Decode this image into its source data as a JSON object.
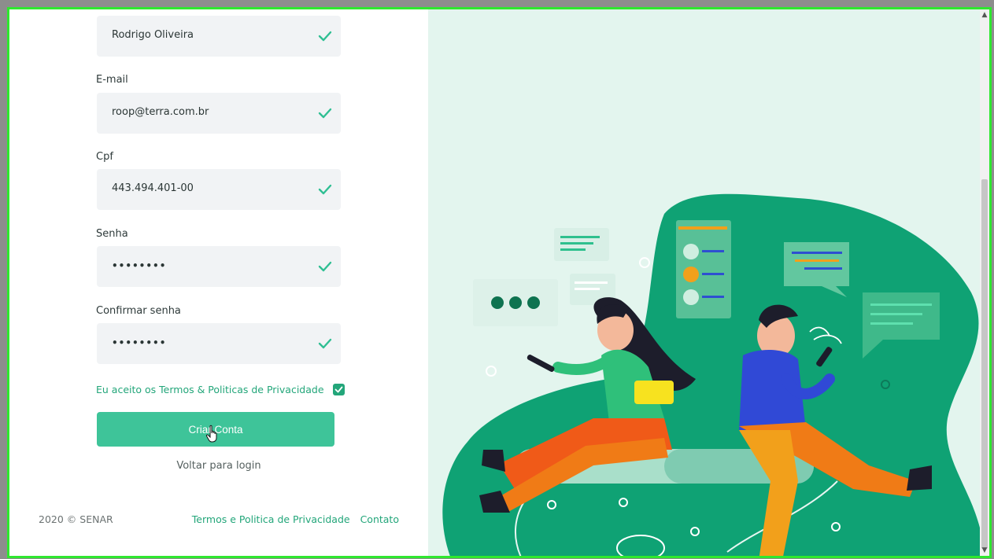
{
  "form": {
    "name_value": "Rodrigo Oliveira",
    "email_label": "E-mail",
    "email_value": "roop@terra.com.br",
    "cpf_label": "Cpf",
    "cpf_value": "443.494.401-00",
    "password_label": "Senha",
    "password_value": "••••••••",
    "confirm_label": "Confirmar senha",
    "confirm_value": "••••••••",
    "terms_text": "Eu aceito os Termos & Politicas de Privacidade",
    "terms_checked": true,
    "submit_label": "Criar Conta",
    "back_link": "Voltar para login"
  },
  "footer": {
    "copyright": "2020 © SENAR",
    "terms_link": "Termos e Politica de Privacidade",
    "contact_link": "Contato"
  },
  "colors": {
    "accent": "#3ec499",
    "link": "#23a67a",
    "illustration_bg": "#e3f5ee",
    "illustration_green": "#0fa274"
  },
  "icons": {
    "field_valid": "check-icon",
    "terms": "checkbox-checked-icon",
    "cursor": "hand-pointer-icon"
  }
}
